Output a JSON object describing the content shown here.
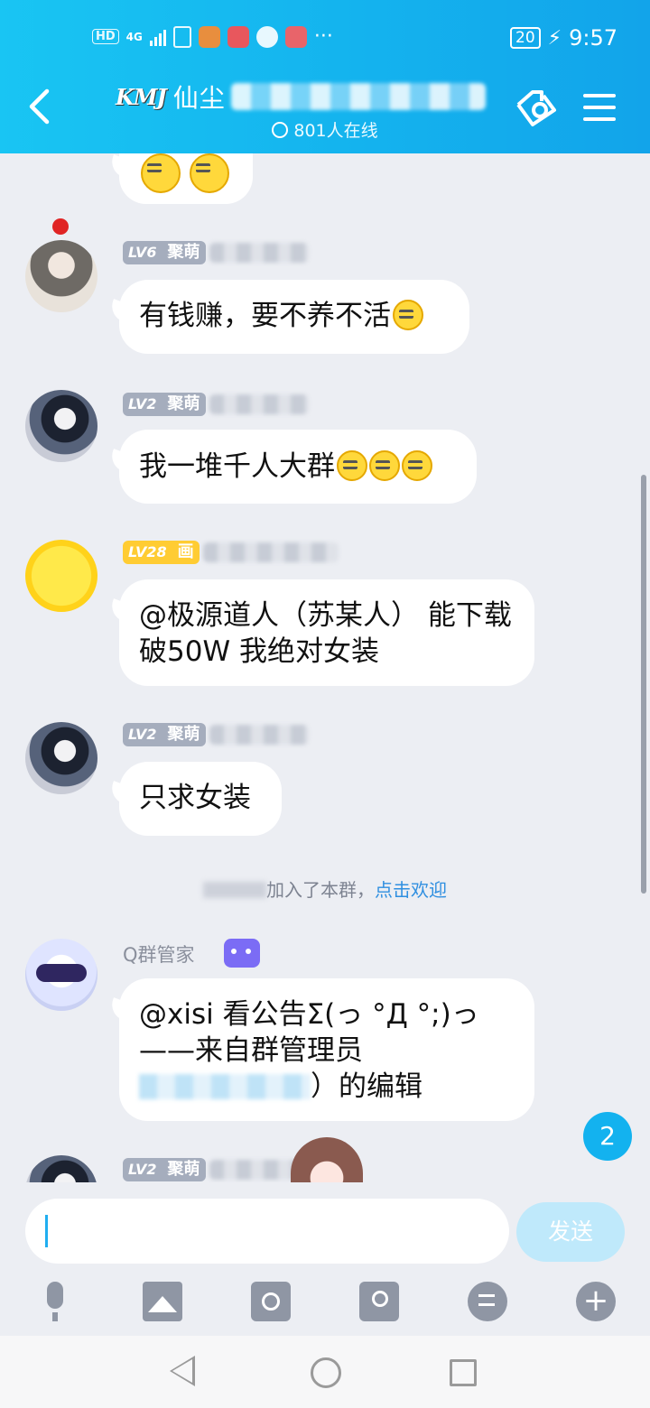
{
  "status_bar": {
    "network": "HD",
    "signal": "4G",
    "battery": "20",
    "time": "9:57",
    "more": "···"
  },
  "header": {
    "logo": "KMJ",
    "title": "仙尘",
    "online_count": "801人在线",
    "back_icon": "chevron-left-icon",
    "link_icon": "link-icon",
    "menu_icon": "menu-icon"
  },
  "messages": [
    {
      "level": "LV6",
      "role": "聚萌",
      "text": "有钱赚，要不养不活",
      "emoji": "crying-laugh-emoji"
    },
    {
      "level": "LV2",
      "role": "聚萌",
      "text": "我一堆千人大群",
      "emoji": "smug-emoji"
    },
    {
      "level": "LV28",
      "role": "画",
      "text": "@极源道人（苏某人） 能下载破50W 我绝对女装"
    },
    {
      "level": "LV2",
      "role": "聚萌",
      "text": "只求女装"
    }
  ],
  "system_notice": {
    "text": "加入了本群，",
    "action": "点击欢迎"
  },
  "manager_message": {
    "sender": "Q群管家",
    "line1": "@xisi 看公告Σ(っ °Д °;)っ",
    "line2": "——来自群管理员",
    "line3_suffix": "）的编辑"
  },
  "last_preview": {
    "level": "LV2",
    "role": "聚萌"
  },
  "unread_badge": "2",
  "input": {
    "value": "",
    "send_label": "发送"
  },
  "toolbar": [
    "mic-icon",
    "image-icon",
    "camera-icon",
    "red-packet-icon",
    "emoji-icon",
    "plus-icon"
  ],
  "nav_bar": [
    "back-triangle-icon",
    "home-circle-icon",
    "recent-square-icon"
  ],
  "colors": {
    "header_bg": "#14b3ee",
    "chat_bg": "#eceef3",
    "accent": "#13b2ef",
    "level_badge": "#a5adbd",
    "level_badge_gold": "#ffcc33"
  }
}
